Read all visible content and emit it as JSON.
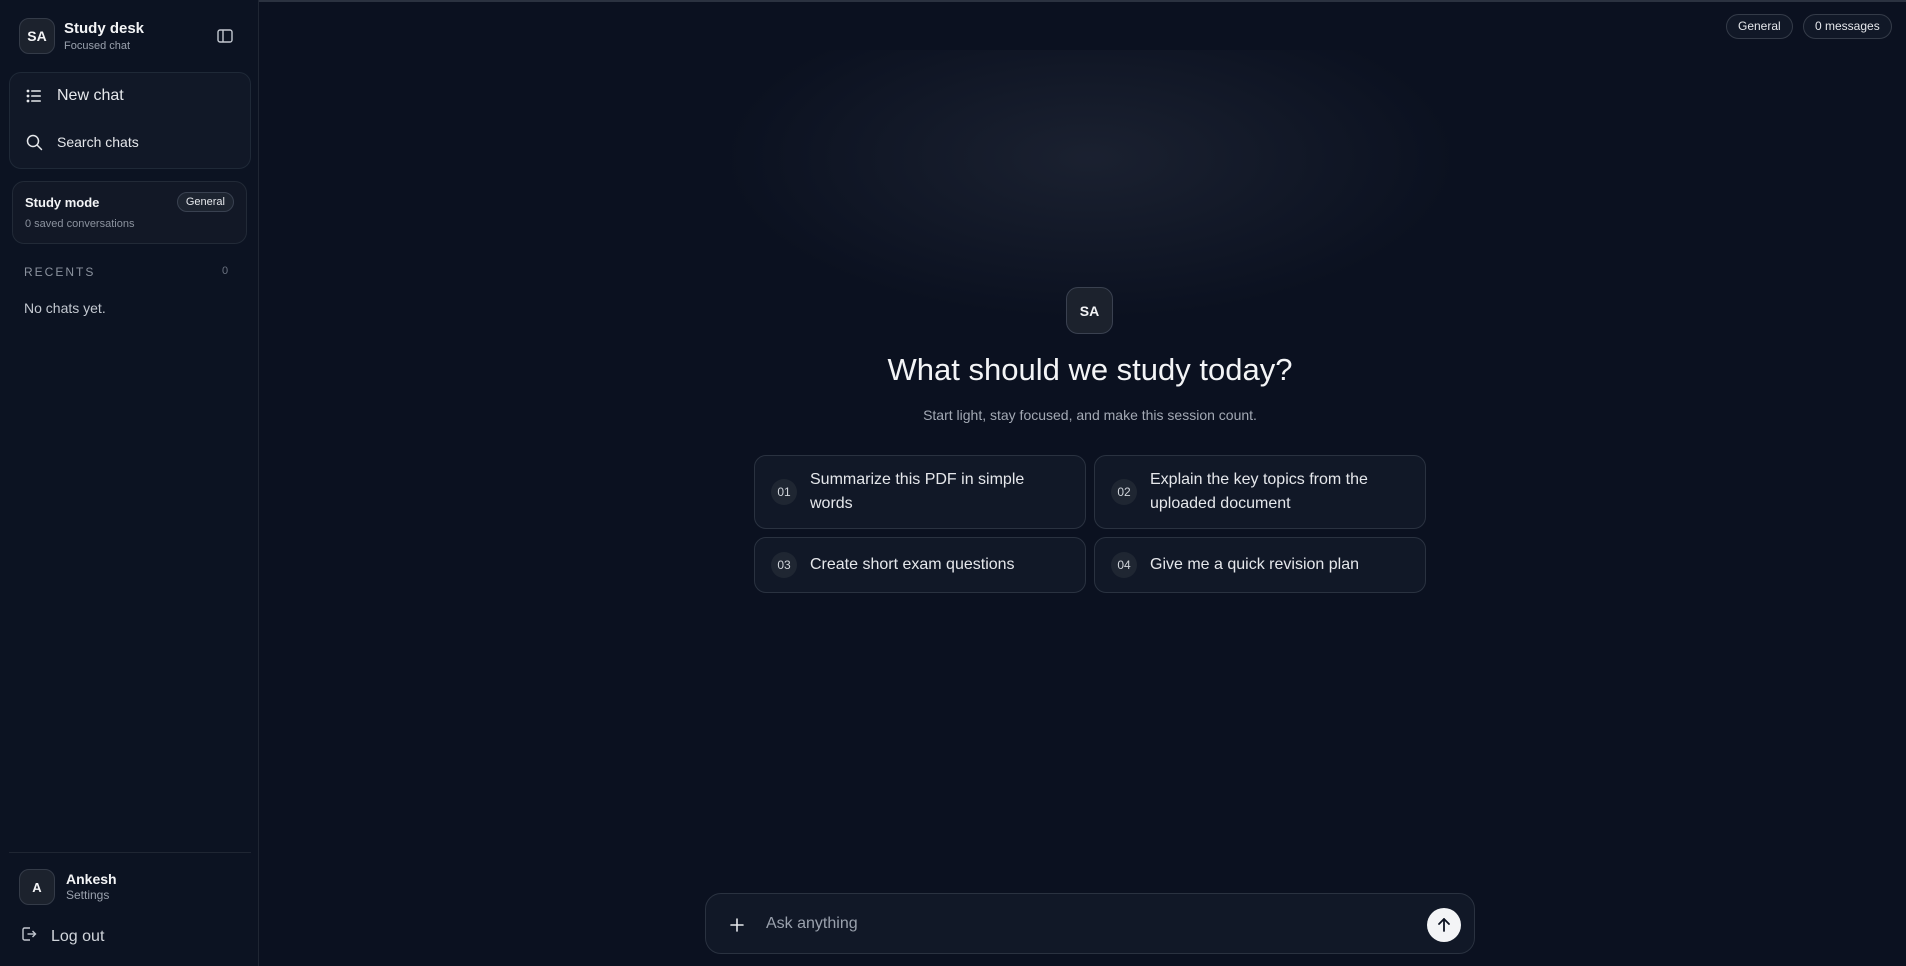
{
  "brand": {
    "initials": "SA",
    "title": "Study desk",
    "subtitle": "Focused chat"
  },
  "nav": {
    "new_chat": "New chat",
    "search_chats": "Search chats"
  },
  "study_mode": {
    "title": "Study mode",
    "badge": "General",
    "subtitle": "0 saved conversations"
  },
  "recents": {
    "label": "RECENTS",
    "count": "0",
    "empty": "No chats yet."
  },
  "user": {
    "initial": "A",
    "name": "Ankesh",
    "settings": "Settings"
  },
  "logout_label": "Log out",
  "header": {
    "mode_pill": "General",
    "messages_pill": "0 messages"
  },
  "hero": {
    "initials": "SA",
    "title": "What should we study today?",
    "subtitle": "Start light, stay focused, and make this session count."
  },
  "suggestions": [
    {
      "num": "01",
      "text": "Summarize this PDF in simple words"
    },
    {
      "num": "02",
      "text": "Explain the key topics from the uploaded document"
    },
    {
      "num": "03",
      "text": "Create short exam questions"
    },
    {
      "num": "04",
      "text": "Give me a quick revision plan"
    }
  ],
  "composer": {
    "placeholder": "Ask anything"
  },
  "icons": {
    "panel": "panel-toggle-icon",
    "new_chat": "new-chat-icon",
    "search": "search-icon",
    "logout": "logout-icon",
    "plus": "plus-icon",
    "send": "arrow-up-icon"
  }
}
